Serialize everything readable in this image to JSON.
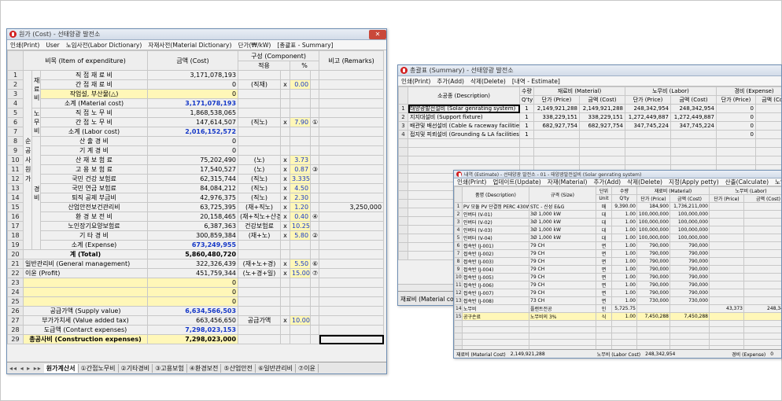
{
  "w1": {
    "title": "원가 (Cost) - 선태양광 발전소",
    "menu": [
      "인쇄(Print)",
      "User",
      "노임사전(Labor Dictionary)",
      "자재사전(Material Dictionary)",
      "단가(₩/kW)",
      "[총괄표 - Summary]"
    ],
    "head": {
      "item": "비목 (Item of expenditure)",
      "amount": "금액 (Cost)",
      "comp": "구성 (Component)",
      "apply": "적용",
      "pct": "%",
      "remarks": "비고 (Remarks)"
    },
    "groups": {
      "net": "순공사원가",
      "mat": "재료비",
      "lab": "노무비",
      "exp": "경비"
    },
    "rows": [
      {
        "n": "1",
        "label": "직 접 재 료 비",
        "amt": "3,171,078,193",
        "apply": "",
        "x": "",
        "pct": "",
        "note": "",
        "rem": ""
      },
      {
        "n": "2",
        "label": "간 접 재 료 비",
        "amt": "0",
        "apply": "(직재)",
        "x": "x",
        "pct": "0.00",
        "note": "",
        "rem": ""
      },
      {
        "n": "3",
        "label": "작업설, 부산물(△)",
        "amt": "0",
        "apply": "",
        "x": "",
        "pct": "",
        "note": "",
        "rem": ""
      },
      {
        "n": "4",
        "label": "소계 (Material cost)",
        "amt": "3,171,078,193",
        "apply": "",
        "x": "",
        "pct": "",
        "note": "",
        "rem": ""
      },
      {
        "n": "5",
        "label": "직 접 노 무 비",
        "amt": "1,868,538,065",
        "apply": "",
        "x": "",
        "pct": "",
        "note": "",
        "rem": ""
      },
      {
        "n": "6",
        "label": "간 접 노 무 비",
        "amt": "147,614,507",
        "apply": "(직노)",
        "x": "x",
        "pct": "7.90",
        "note": "①",
        "rem": ""
      },
      {
        "n": "7",
        "label": "소계 (Labor cost)",
        "amt": "2,016,152,572",
        "apply": "",
        "x": "",
        "pct": "",
        "note": "",
        "rem": ""
      },
      {
        "n": "8",
        "label": "산 출 경 비",
        "amt": "0",
        "apply": "",
        "x": "",
        "pct": "",
        "note": "",
        "rem": ""
      },
      {
        "n": "9",
        "label": "기 계 경 비",
        "amt": "0",
        "apply": "",
        "x": "",
        "pct": "",
        "note": "",
        "rem": ""
      },
      {
        "n": "10",
        "label": "산 재 보 험 료",
        "amt": "75,202,490",
        "apply": "(노)",
        "x": "x",
        "pct": "3.73",
        "note": "",
        "rem": ""
      },
      {
        "n": "11",
        "label": "고 용 보 험 료",
        "amt": "17,540,527",
        "apply": "(노)",
        "x": "x",
        "pct": "0.87",
        "note": "③",
        "rem": ""
      },
      {
        "n": "12",
        "label": "국민 건강 보험료",
        "amt": "62,315,744",
        "apply": "(직노)",
        "x": "x",
        "pct": "3.335",
        "note": "",
        "rem": ""
      },
      {
        "n": "13",
        "label": "국민 연금 보험료",
        "amt": "84,084,212",
        "apply": "(직노)",
        "x": "x",
        "pct": "4.50",
        "note": "",
        "rem": ""
      },
      {
        "n": "14",
        "label": "퇴직 공제 부금비",
        "amt": "42,976,375",
        "apply": "(직노)",
        "x": "x",
        "pct": "2.30",
        "note": "",
        "rem": ""
      },
      {
        "n": "15",
        "label": "산업안전보건관리비",
        "amt": "63,725,395",
        "apply": "(재+직노)",
        "x": "x",
        "pct": "1.20",
        "note": "",
        "rem": "3,250,000"
      },
      {
        "n": "16",
        "label": "환 경 보 전 비",
        "amt": "20,158,465",
        "apply": "(재+직노+산경)",
        "x": "x",
        "pct": "0.40",
        "note": "④",
        "rem": ""
      },
      {
        "n": "17",
        "label": "노인장기요양보험료",
        "amt": "6,387,363",
        "apply": "건강보험료",
        "x": "x",
        "pct": "10.25",
        "note": "",
        "rem": ""
      },
      {
        "n": "18",
        "label": "기 타 경 비",
        "amt": "300,859,384",
        "apply": "(재+노)",
        "x": "x",
        "pct": "5.80",
        "note": "②",
        "rem": ""
      },
      {
        "n": "19",
        "label": "소계 (Expense)",
        "amt": "673,249,955",
        "apply": "",
        "x": "",
        "pct": "",
        "note": "",
        "rem": ""
      },
      {
        "n": "20",
        "label": "계 (Total)",
        "amt": "5,860,480,720",
        "apply": "",
        "x": "",
        "pct": "",
        "note": "",
        "rem": ""
      },
      {
        "n": "21",
        "label": "일반관리비 (General management)",
        "amt": "322,326,439",
        "apply": "(재+노+경)",
        "x": "x",
        "pct": "5.50",
        "note": "⑥",
        "rem": ""
      },
      {
        "n": "22",
        "label": "이윤 (Profit)",
        "amt": "451,759,344",
        "apply": "(노+경+일)",
        "x": "x",
        "pct": "15.00",
        "note": "⑦",
        "rem": ""
      },
      {
        "n": "23",
        "label": "",
        "amt": "0",
        "apply": "",
        "x": "",
        "pct": "",
        "note": "",
        "rem": ""
      },
      {
        "n": "24",
        "label": "",
        "amt": "0",
        "apply": "",
        "x": "",
        "pct": "",
        "note": "",
        "rem": ""
      },
      {
        "n": "25",
        "label": "",
        "amt": "0",
        "apply": "",
        "x": "",
        "pct": "",
        "note": "",
        "rem": ""
      },
      {
        "n": "26",
        "label": "공급가액 (Supply value)",
        "amt": "6,634,566,503",
        "apply": "",
        "x": "",
        "pct": "",
        "note": "",
        "rem": ""
      },
      {
        "n": "27",
        "label": "부가가치세 (Value added tax)",
        "amt": "663,456,650",
        "apply": "공급가액",
        "x": "x",
        "pct": "10.00",
        "note": "",
        "rem": ""
      },
      {
        "n": "28",
        "label": "도급액 (Contarct expenses)",
        "amt": "7,298,023,153",
        "apply": "",
        "x": "",
        "pct": "",
        "note": "",
        "rem": ""
      },
      {
        "n": "29",
        "label": "총공사비 (Construction expenses)",
        "amt": "7,298,023,000",
        "apply": "",
        "x": "",
        "pct": "",
        "note": "",
        "rem": ""
      }
    ],
    "tabs": [
      "원가계산서",
      "①간접노무비",
      "②기타경비",
      "③고용보험",
      "④환경보전",
      "⑤산업안전",
      "⑥일반관리비",
      "⑦이윤"
    ]
  },
  "w2": {
    "title": "총괄표 (Summary) - 선태양광 발전소",
    "menu": [
      "인쇄(Print)",
      "추가(Add)",
      "삭제(Delete)",
      "[내역 - Estimate]"
    ],
    "head": {
      "desc": "소공종 (Description)",
      "qty1": "수량",
      "qty2": "Q'ty",
      "mat": "재료비 (Material)",
      "lab": "노무비 (Labor)",
      "exp": "경비 (Expense)",
      "price": "단가 (Price)",
      "cost": "금액 (Cost)",
      "cost2": "금액 (Cos"
    },
    "rows": [
      {
        "n": "1",
        "d": "태양광발전설비 (Solar genrating system)",
        "q": "1",
        "mp": "2,149,921,288",
        "mc": "2,149,921,288",
        "lp": "248,342,954",
        "lc": "248,342,954",
        "ep": "0"
      },
      {
        "n": "2",
        "d": "지지대설비 (Support fixture)",
        "q": "1",
        "mp": "338,229,151",
        "mc": "338,229,151",
        "lp": "1,272,449,887",
        "lc": "1,272,449,887",
        "ep": "0"
      },
      {
        "n": "3",
        "d": "배관및 배선설비 (Cable & raceway facilities)",
        "q": "1",
        "mp": "682,927,754",
        "mc": "682,927,754",
        "lp": "347,745,224",
        "lc": "347,745,224",
        "ep": "0"
      },
      {
        "n": "4",
        "d": "접지및 피뢰설비 (Grounding & LA facilities)",
        "q": "1",
        "mp": "",
        "mc": "",
        "lp": "",
        "lc": "",
        "ep": "0"
      }
    ],
    "sheet": "재료비 (Material cost)"
  },
  "w3": {
    "title": "내역 (Estimate) - 선태양광 발전소 - 01 - 태양광발전설비 (Solar genrating system)",
    "menu": [
      "인쇄(Print)",
      "업데이트(Update)",
      "자재(Material)",
      "추가(Add)",
      "삭제(Delete)",
      "지정(Apply petty)",
      "산출(Calculate)",
      "노임(Labor price)",
      "화면(View)",
      "[수량산출 - Quantity calcu"
    ],
    "head": {
      "name": "품명 (Description)",
      "spec": "규격 (Size)",
      "unit1": "단위",
      "unit2": "Unit",
      "qty1": "수량",
      "qty2": "Q'ty",
      "mat": "재료비 (Material)",
      "lab": "노무비 (Labor)",
      "price": "단가 (Price)",
      "cost": "금액 (Cost)"
    },
    "rows": [
      {
        "n": "1",
        "d": "PV 모듈 PV 단결정 PERC 430Wp",
        "s": "STC - 신성 E&G",
        "u": "매",
        "q": "9,390.00",
        "p": "184,900",
        "c": "1,736,211,000",
        "lp": "",
        "lc": ""
      },
      {
        "n": "2",
        "d": "인버터 (V-01)",
        "s": "3Ø 1,000 kW",
        "u": "대",
        "q": "1.00",
        "p": "100,000,000",
        "c": "100,000,000",
        "lp": "",
        "lc": ""
      },
      {
        "n": "3",
        "d": "인버터 (V-02)",
        "s": "3Ø 1,000 kW",
        "u": "대",
        "q": "1.00",
        "p": "100,000,000",
        "c": "100,000,000",
        "lp": "",
        "lc": ""
      },
      {
        "n": "4",
        "d": "인버터 (V-03)",
        "s": "3Ø 1,000 kW",
        "u": "대",
        "q": "1.00",
        "p": "100,000,000",
        "c": "100,000,000",
        "lp": "",
        "lc": ""
      },
      {
        "n": "5",
        "d": "인버터 (V-04)",
        "s": "3Ø 1,000 kW",
        "u": "대",
        "q": "1.00",
        "p": "100,000,000",
        "c": "100,000,000",
        "lp": "",
        "lc": ""
      },
      {
        "n": "6",
        "d": "접속반 (J-001)",
        "s": "79 CH",
        "u": "면",
        "q": "1.00",
        "p": "790,000",
        "c": "790,000",
        "lp": "",
        "lc": ""
      },
      {
        "n": "7",
        "d": "접속반 (J-002)",
        "s": "79 CH",
        "u": "면",
        "q": "1.00",
        "p": "790,000",
        "c": "790,000",
        "lp": "",
        "lc": ""
      },
      {
        "n": "8",
        "d": "접속반 (J-003)",
        "s": "79 CH",
        "u": "면",
        "q": "1.00",
        "p": "790,000",
        "c": "790,000",
        "lp": "",
        "lc": ""
      },
      {
        "n": "9",
        "d": "접속반 (J-004)",
        "s": "79 CH",
        "u": "면",
        "q": "1.00",
        "p": "790,000",
        "c": "790,000",
        "lp": "",
        "lc": ""
      },
      {
        "n": "10",
        "d": "접속반 (J-005)",
        "s": "79 CH",
        "u": "면",
        "q": "1.00",
        "p": "790,000",
        "c": "790,000",
        "lp": "",
        "lc": ""
      },
      {
        "n": "11",
        "d": "접속반 (J-006)",
        "s": "79 CH",
        "u": "면",
        "q": "1.00",
        "p": "790,000",
        "c": "790,000",
        "lp": "",
        "lc": ""
      },
      {
        "n": "12",
        "d": "접속반 (J-007)",
        "s": "79 CH",
        "u": "면",
        "q": "1.00",
        "p": "790,000",
        "c": "790,000",
        "lp": "",
        "lc": ""
      },
      {
        "n": "13",
        "d": "접속반 (J-008)",
        "s": "73 CH",
        "u": "면",
        "q": "1.00",
        "p": "730,000",
        "c": "730,000",
        "lp": "",
        "lc": ""
      },
      {
        "n": "14",
        "d": "노무비",
        "s": "플랜트전공",
        "u": "인",
        "q": "5,725.75",
        "p": "",
        "c": "",
        "lp": "43,373",
        "lc": "248,34"
      },
      {
        "n": "15",
        "d": "공구손료",
        "s": "노무비의 3%",
        "u": "식",
        "q": "1.00",
        "p": "7,450,288",
        "c": "7,450,288",
        "lp": "",
        "lc": ""
      }
    ],
    "status": {
      "mat_label": "재료비 (Material Cost)",
      "mat_val": "2,149,921,288",
      "lab_label": "노무비 (Labor Cost)",
      "lab_val": "248,342,954",
      "exp_label": "경비 (Expense)",
      "exp_val": "0"
    }
  }
}
